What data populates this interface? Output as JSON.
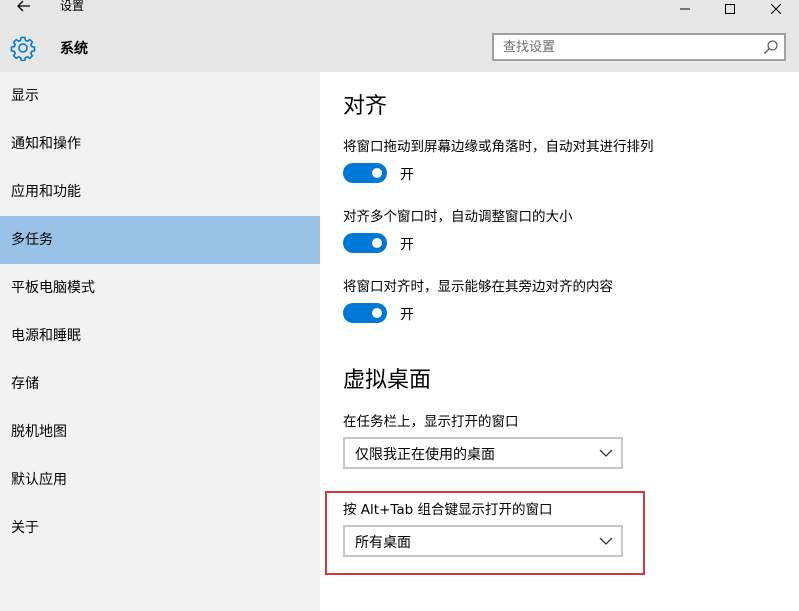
{
  "window": {
    "title": "设置",
    "back_icon": "arrow-left-icon",
    "controls": [
      "minimize-icon",
      "maximize-icon",
      "close-icon"
    ]
  },
  "header": {
    "icon": "gear-icon",
    "title": "系统",
    "search": {
      "placeholder": "查找设置",
      "value": "",
      "icon": "search-icon"
    }
  },
  "sidebar": {
    "items": [
      {
        "label": "显示",
        "selected": false
      },
      {
        "label": "通知和操作",
        "selected": false
      },
      {
        "label": "应用和功能",
        "selected": false
      },
      {
        "label": "多任务",
        "selected": true
      },
      {
        "label": "平板电脑模式",
        "selected": false
      },
      {
        "label": "电源和睡眠",
        "selected": false
      },
      {
        "label": "存储",
        "selected": false
      },
      {
        "label": "脱机地图",
        "selected": false
      },
      {
        "label": "默认应用",
        "selected": false
      },
      {
        "label": "关于",
        "selected": false
      }
    ]
  },
  "main": {
    "snap": {
      "heading": "对齐",
      "settings": [
        {
          "label": "将窗口拖动到屏幕边缘或角落时，自动对其进行排列",
          "state": "开",
          "on": true
        },
        {
          "label": "对齐多个窗口时，自动调整窗口的大小",
          "state": "开",
          "on": true
        },
        {
          "label": "将窗口对齐时，显示能够在其旁边对齐的内容",
          "state": "开",
          "on": true
        }
      ]
    },
    "virtual_desktops": {
      "heading": "虚拟桌面",
      "taskbar": {
        "label": "在任务栏上，显示打开的窗口",
        "value": "仅限我正在使用的桌面"
      },
      "alt_tab": {
        "label": "按 Alt+Tab 组合键显示打开的窗口",
        "value": "所有桌面"
      }
    }
  },
  "colors": {
    "accent": "#0078d7",
    "selected_nav": "#99c3e6",
    "highlight_border": "#d9363e",
    "header_bg": "#e6e6e6",
    "sidebar_bg": "#f2f2f2"
  }
}
